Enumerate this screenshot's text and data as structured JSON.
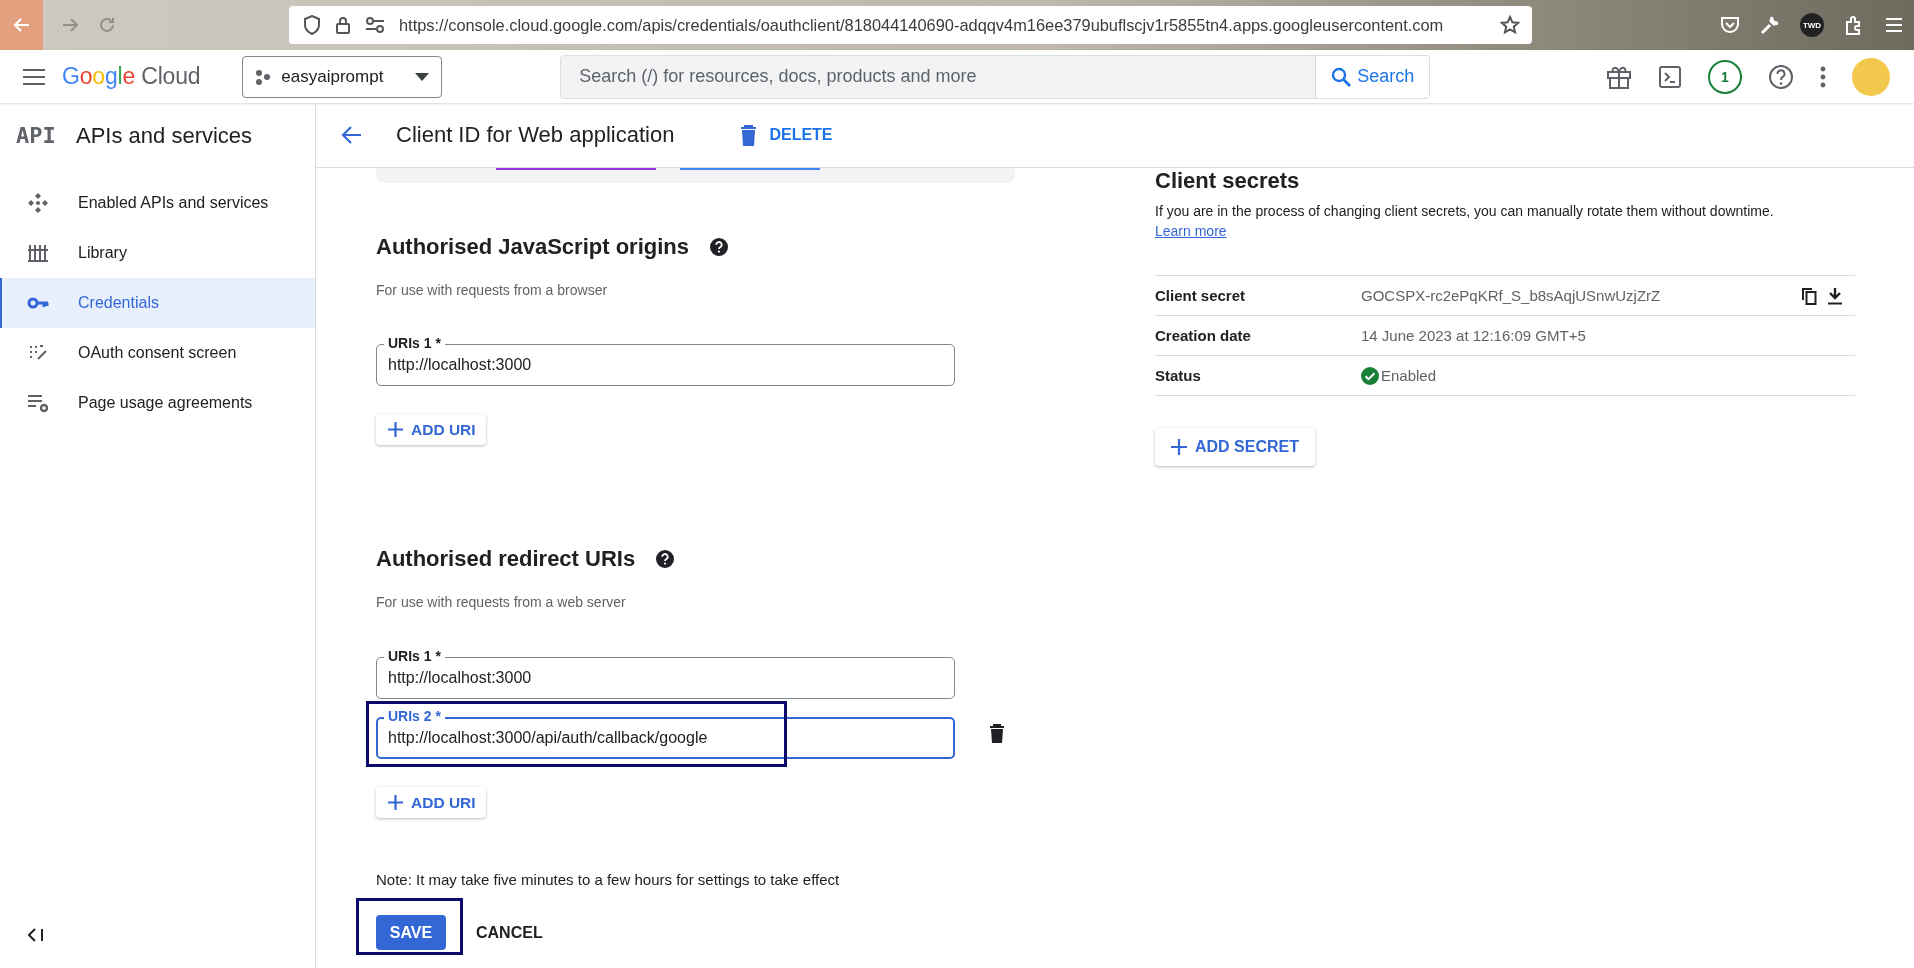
{
  "browser": {
    "url": "https://console.cloud.google.com/apis/credentials/oauthclient/818044140690-adqqv4m16ee379ubuflscjv1r5855tn4.apps.googleusercontent.com",
    "profile_badge": "TWD"
  },
  "header": {
    "logo": "Google Cloud",
    "project": "easyaiprompt",
    "search_placeholder": "Search (/) for resources, docs, products and more",
    "search_button": "Search",
    "notification_count": "1"
  },
  "sidebar": {
    "logo": "API",
    "title": "APIs and services",
    "items": [
      {
        "label": "Enabled APIs and services",
        "kind": "apis",
        "selected": false
      },
      {
        "label": "Library",
        "kind": "library",
        "selected": false
      },
      {
        "label": "Credentials",
        "kind": "key",
        "selected": true
      },
      {
        "label": "OAuth consent screen",
        "kind": "consent",
        "selected": false
      },
      {
        "label": "Page usage agreements",
        "kind": "agreements",
        "selected": false
      }
    ]
  },
  "page": {
    "title": "Client ID for Web application",
    "delete": "DELETE"
  },
  "origins": {
    "heading": "Authorised JavaScript origins",
    "description": "For use with requests from a browser",
    "uris": [
      {
        "label": "URIs 1 *",
        "value": "http://localhost:3000",
        "focused": false,
        "highlighted": false
      }
    ],
    "add": "ADD URI"
  },
  "redirects": {
    "heading": "Authorised redirect URIs",
    "description": "For use with requests from a web server",
    "uris": [
      {
        "label": "URIs 1 *",
        "value": "http://localhost:3000",
        "focused": false,
        "highlighted": false
      },
      {
        "label": "URIs 2 *",
        "value": "http://localhost:3000/api/auth/callback/google",
        "focused": true,
        "highlighted": true
      }
    ],
    "add": "ADD URI"
  },
  "note": "Note: It may take five minutes to a few hours for settings to take effect",
  "save": {
    "label": "SAVE",
    "highlighted": true
  },
  "cancel": "CANCEL",
  "secrets": {
    "heading": "Client secrets",
    "description": "If you are in the process of changing client secrets, you can manually rotate them without downtime.",
    "learn_more": "Learn more",
    "rows": [
      {
        "label": "Client secret",
        "value": "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",
        "kind": "secret"
      },
      {
        "label": "Creation date",
        "value": "14 June 2023 at 12:16:09 GMT+5",
        "kind": "text"
      },
      {
        "label": "Status",
        "value": "Enabled",
        "kind": "status"
      }
    ],
    "add": "ADD SECRET"
  }
}
